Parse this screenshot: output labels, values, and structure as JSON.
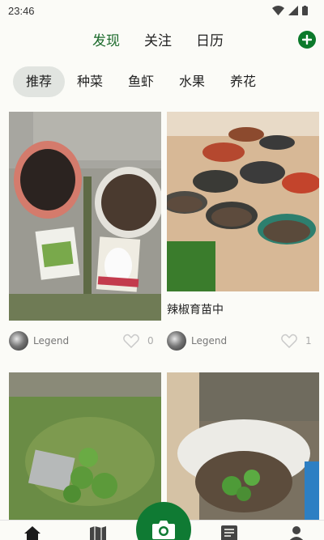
{
  "status": {
    "time": "23:46"
  },
  "top_tabs": [
    {
      "label": "发现",
      "active": true
    },
    {
      "label": "关注",
      "active": false
    },
    {
      "label": "日历",
      "active": false
    }
  ],
  "categories": [
    {
      "label": "推荐",
      "active": true
    },
    {
      "label": "种菜",
      "active": false
    },
    {
      "label": "鱼虾",
      "active": false
    },
    {
      "label": "水果",
      "active": false
    },
    {
      "label": "养花",
      "active": false
    }
  ],
  "feed": [
    {
      "title": "",
      "author": "Legend",
      "likes": "0"
    },
    {
      "title": "辣椒育苗中",
      "author": "Legend",
      "likes": "1"
    },
    {
      "title": "",
      "author": "",
      "likes": ""
    },
    {
      "title": "",
      "author": "",
      "likes": ""
    }
  ],
  "colors": {
    "accent": "#0c7a2b",
    "active_tab": "#1b6a2b",
    "chip_bg": "#e1e4e0"
  },
  "icons": [
    "wifi-icon",
    "signal-icon",
    "battery-icon",
    "add-icon",
    "heart-icon",
    "home-icon",
    "map-icon",
    "camera-icon",
    "message-icon",
    "profile-icon"
  ]
}
